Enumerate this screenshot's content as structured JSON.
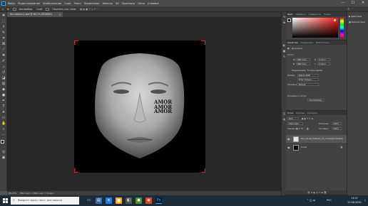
{
  "menubar": {
    "logo": "Ps",
    "items": [
      "Файл",
      "Редактирование",
      "Изображение",
      "Слои",
      "Текст",
      "Выделение",
      "Фильтр",
      "3D",
      "Просмотр",
      "Окно",
      "Справка"
    ],
    "minimize": "—",
    "maximize": "☐",
    "close": "✕"
  },
  "options": {
    "tool": "Автовыбор:",
    "target": "Слой",
    "transform": "Показать упр. элем."
  },
  "tab": {
    "title": "Без-имени-1.psd @ 66,7% (RGB/8#)",
    "close": "×"
  },
  "status": {
    "zoom": "66,67%",
    "doc": "866 пикс. x 866 пикс. (72 ppi)"
  },
  "color_panel": {
    "tabs": [
      "Цвет",
      "Образцы",
      "Градиенты",
      "Узоры"
    ],
    "hue_colors": [
      "#ff0000",
      "#ffff00",
      "#00ff00",
      "#00ffff",
      "#0000ff",
      "#ff00ff",
      "#ff0000"
    ]
  },
  "properties_panel": {
    "tabs": [
      "Свойства",
      "Коррекция",
      "Библиотеки"
    ],
    "title": "Документ",
    "section_canvas": "Холст",
    "w_label": "Ш",
    "w_value": "866 пикс.",
    "h_label": "В",
    "h_value": "866 пикс.",
    "x_label": "X",
    "x_value": "0 пикс.",
    "y_label": "Y",
    "y_value": "0 пикс.",
    "resolution": "Разрешение: 72 пикс/дюйм",
    "mode_label": "Режим",
    "mode_value": "Цвета RGB",
    "depth_value": "8 бит/канал",
    "fill_label": "Заливка",
    "fill_value": "Белый",
    "section_rulers": "Линейки и сетки",
    "cm_value": "Сантиметры"
  },
  "layers_panel": {
    "tabs": [
      "Слои",
      "Каналы",
      "Контуры"
    ],
    "kind": "Вид",
    "blend": "Обычные",
    "opacity_label": "Непрозр.:",
    "opacity_value": "100%",
    "fill_label": "Заливка:",
    "fill_value": "100%",
    "lock_label": "Закреп.:",
    "layers": [
      {
        "name": "face_01.psd_Fullbody_01_normal@ornamentr",
        "selected": true
      },
      {
        "name": "Слой",
        "selected": false
      }
    ]
  },
  "collapsed_panels": {
    "items": [
      "Действия",
      "Библиотеки"
    ]
  },
  "taskbar": {
    "search_placeholder": "Введите здесь текст для поиска",
    "lang": "РУС",
    "time": "13:37",
    "date": "25.06.2020"
  },
  "canvas": {
    "text_lines": [
      "AMOR",
      "AMOR",
      "AMOR"
    ]
  }
}
